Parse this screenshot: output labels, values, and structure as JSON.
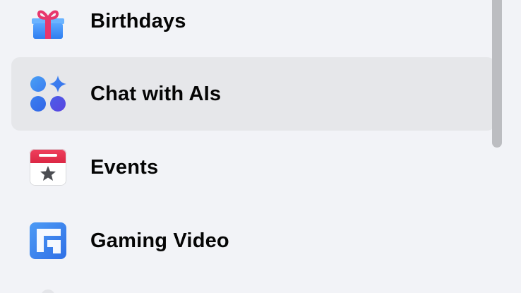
{
  "menu": {
    "items": [
      {
        "label": "Birthdays",
        "icon": "gift-icon"
      },
      {
        "label": "Chat with AIs",
        "icon": "ai-chat-icon",
        "active": true
      },
      {
        "label": "Events",
        "icon": "calendar-star-icon"
      },
      {
        "label": "Gaming Video",
        "icon": "gaming-video-icon"
      }
    ]
  },
  "colors": {
    "background": "#f2f3f7",
    "active_row": "#e6e7ea",
    "text": "#050505",
    "scrollbar_thumb": "#bcbdc1",
    "gift_box": "#3f8ff6",
    "gift_ribbon": "#e8366c",
    "ai_dots_blue": "#3a7df0",
    "ai_dots_purple": "#5b45e0",
    "events_red": "#e8334a",
    "gaming_blue": "#3c86ee"
  }
}
